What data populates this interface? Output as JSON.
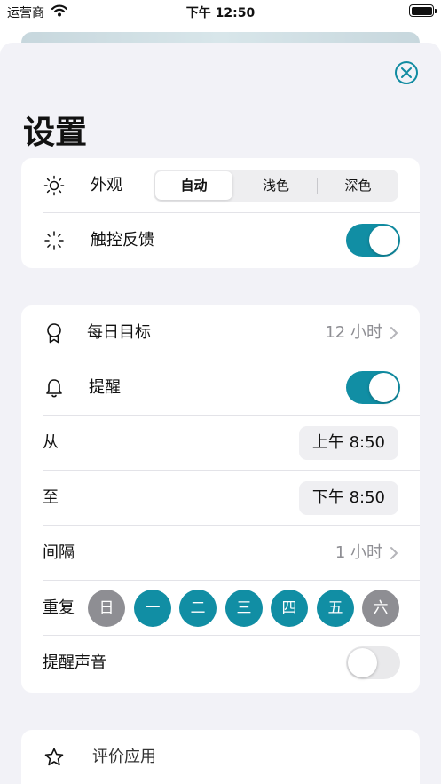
{
  "status_bar": {
    "carrier": "运营商",
    "time": "下午 12:50"
  },
  "page": {
    "title": "设置"
  },
  "colors": {
    "accent": "#118ea4",
    "day_off": "#8e8e93",
    "toggle_off": "#e9e9eb",
    "background": "#f2f2f7"
  },
  "appearance": {
    "label": "外观",
    "icon": "sun-icon",
    "options": [
      "自动",
      "浅色",
      "深色"
    ],
    "selected": "自动"
  },
  "haptics": {
    "label": "触控反馈",
    "icon": "haptic-icon",
    "on": true
  },
  "daily_goal": {
    "label": "每日目标",
    "value": "12 小时",
    "icon": "award-icon"
  },
  "reminder": {
    "label": "提醒",
    "icon": "bell-icon",
    "on": true
  },
  "from": {
    "label": "从",
    "value": "上午 8:50"
  },
  "to": {
    "label": "至",
    "value": "下午 8:50"
  },
  "interval": {
    "label": "间隔",
    "value": "1 小时"
  },
  "repeat": {
    "label": "重复",
    "days": [
      {
        "label": "日",
        "on": false
      },
      {
        "label": "一",
        "on": true
      },
      {
        "label": "二",
        "on": true
      },
      {
        "label": "三",
        "on": true
      },
      {
        "label": "四",
        "on": true
      },
      {
        "label": "五",
        "on": true
      },
      {
        "label": "六",
        "on": false
      }
    ]
  },
  "reminder_sound": {
    "label": "提醒声音",
    "on": false
  },
  "rate": {
    "label": "评价应用",
    "icon": "star-icon"
  }
}
